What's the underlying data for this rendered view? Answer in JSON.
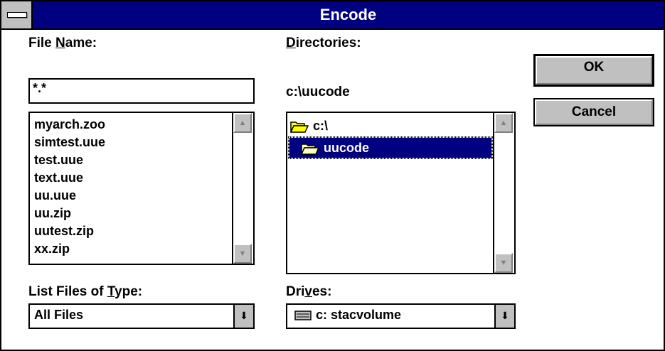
{
  "window": {
    "title": "Encode"
  },
  "filename": {
    "label_pre": "File ",
    "label_key": "N",
    "label_post": "ame:",
    "value": "*.*",
    "files": [
      "myarch.zoo",
      "simtest.uue",
      "test.uue",
      "text.uue",
      "uu.uue",
      "uu.zip",
      "uutest.zip",
      "xx.zip"
    ]
  },
  "directories": {
    "label_key": "D",
    "label_post": "irectories:",
    "current_path": "c:\\uucode",
    "items": [
      {
        "name": "c:\\",
        "icon": "open-folder-icon",
        "selected": false
      },
      {
        "name": "uucode",
        "icon": "open-folder-icon",
        "selected": true
      }
    ]
  },
  "filetype": {
    "label_pre": "List Files of ",
    "label_key": "T",
    "label_post": "ype:",
    "value": "All Files"
  },
  "drives": {
    "label_pre": "Dri",
    "label_key": "v",
    "label_post": "es:",
    "value": "c: stacvolume",
    "icon": "hard-drive-icon"
  },
  "buttons": {
    "ok": "OK",
    "cancel": "Cancel"
  },
  "colors": {
    "titlebar": "#000080",
    "face": "#c0c0c0",
    "selection": "#000080"
  }
}
